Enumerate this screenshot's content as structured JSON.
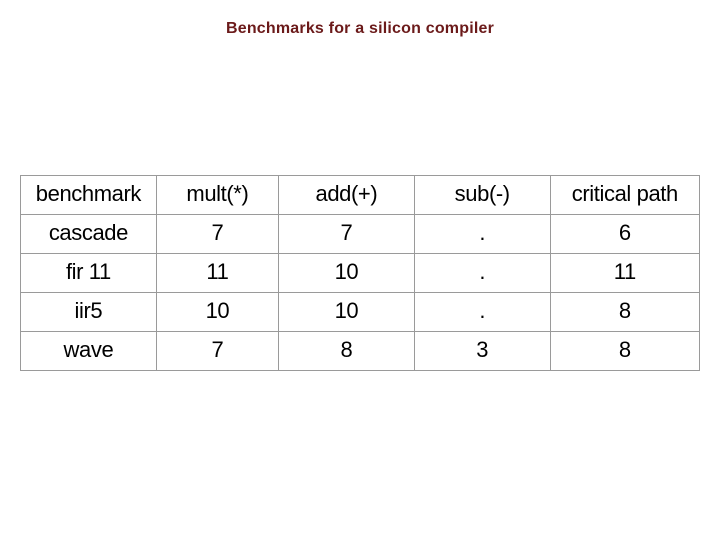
{
  "title": "Benchmarks for a silicon compiler",
  "table": {
    "headers": [
      "benchmark",
      "mult(*)",
      "add(+)",
      "sub(-)",
      "critical path"
    ],
    "rows": [
      {
        "cells": [
          "cascade",
          "7",
          "7",
          ".",
          "6"
        ]
      },
      {
        "cells": [
          "fir 11",
          "11",
          "10",
          ".",
          "11"
        ]
      },
      {
        "cells": [
          "iir5",
          "10",
          "10",
          ".",
          "8"
        ]
      },
      {
        "cells": [
          "wave",
          "7",
          "8",
          "3",
          "8"
        ]
      }
    ]
  },
  "chart_data": {
    "type": "table",
    "title": "Benchmarks for a silicon compiler",
    "columns": [
      "benchmark",
      "mult(*)",
      "add(+)",
      "sub(-)",
      "critical path"
    ],
    "rows": [
      [
        "cascade",
        7,
        7,
        null,
        6
      ],
      [
        "fir 11",
        11,
        10,
        null,
        11
      ],
      [
        "iir5",
        10,
        10,
        null,
        8
      ],
      [
        "wave",
        7,
        8,
        3,
        8
      ]
    ]
  }
}
